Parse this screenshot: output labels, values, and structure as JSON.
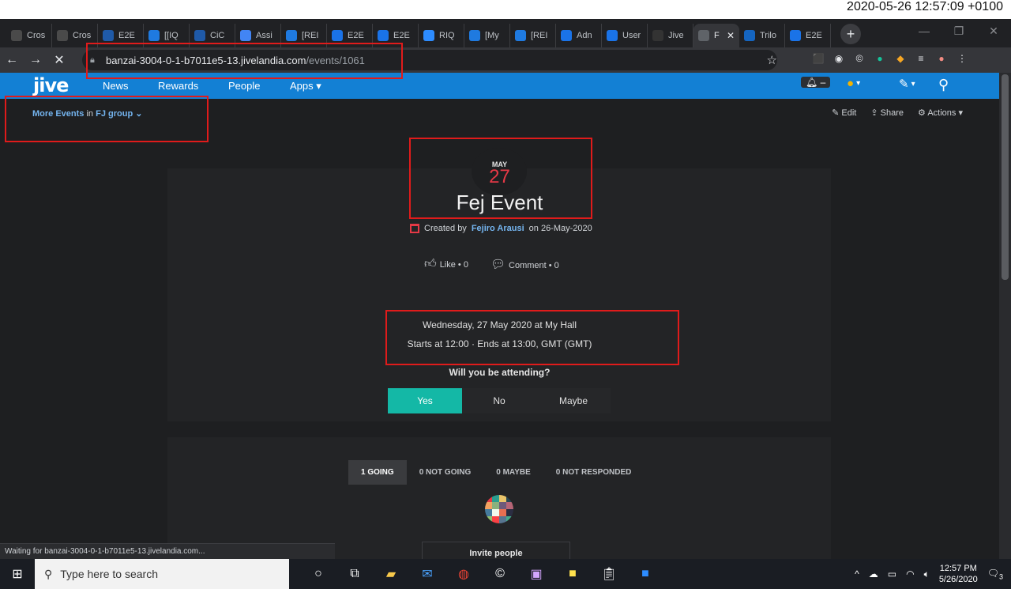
{
  "timestamp": "2020-05-26 12:57:09 +0100",
  "browser": {
    "tabs": [
      {
        "label": "Cros",
        "color": "#4a4a4a"
      },
      {
        "label": "Cros",
        "color": "#4a4a4a"
      },
      {
        "label": "E2E",
        "color": "#1f5aa8"
      },
      {
        "label": "[[IQ",
        "color": "#1f7ae0"
      },
      {
        "label": "CiC",
        "color": "#1f5aa8"
      },
      {
        "label": "Assi",
        "color": "#4285f4"
      },
      {
        "label": "[REI",
        "color": "#1f7ae0"
      },
      {
        "label": "E2E",
        "color": "#1a73e8"
      },
      {
        "label": "E2E",
        "color": "#1a73e8"
      },
      {
        "label": "RIQ",
        "color": "#2d8cff"
      },
      {
        "label": "[My",
        "color": "#1f7ae0"
      },
      {
        "label": "[REI",
        "color": "#1f7ae0"
      },
      {
        "label": "Adn",
        "color": "#1a73e8"
      },
      {
        "label": "User",
        "color": "#1a73e8"
      },
      {
        "label": "Jive",
        "color": "#333333"
      },
      {
        "label": "F",
        "color": "#5f6368",
        "active": true
      },
      {
        "label": "Trilo",
        "color": "#1565c0"
      },
      {
        "label": "E2E",
        "color": "#1a73e8"
      }
    ],
    "url_host": "banzai-3004-0-1-b7011e5-13.jivelandia.com",
    "url_path": "/events/1061",
    "status_text": "Waiting for banzai-3004-0-1-b7011e5-13.jivelandia.com..."
  },
  "jive": {
    "logo": "jive",
    "nav": [
      "News",
      "Rewards",
      "People",
      "Apps ▾"
    ],
    "notifications": "–",
    "more_events": "More Events",
    "in_text": "in",
    "group": "FJ group",
    "actions": [
      "Edit",
      "Share",
      "Actions ▾"
    ]
  },
  "event": {
    "month": "MAY",
    "day": "27",
    "title": "Fej Event",
    "created_prefix": "Created by",
    "author": "Fejiro Arausi",
    "created_suffix": "on 26-May-2020",
    "like_label": "Like",
    "like_count": "0",
    "comment_label": "Comment",
    "comment_count": "0",
    "when_line1": "Wednesday, 27 May 2020 at My Hall",
    "when_line2": "Starts at 12:00 · Ends at 13:00, GMT (GMT)",
    "attend_question": "Will you be attending?",
    "rsvp": [
      "Yes",
      "No",
      "Maybe"
    ],
    "rsvp_selected": "Yes",
    "attendance_tabs": [
      "1 GOING",
      "0 NOT GOING",
      "0 MAYBE",
      "0 NOT RESPONDED"
    ],
    "invite_label": "Invite people"
  },
  "taskbar": {
    "search_placeholder": "Type here to search",
    "time": "12:57 PM",
    "date": "5/26/2020",
    "notification_count": "3"
  }
}
